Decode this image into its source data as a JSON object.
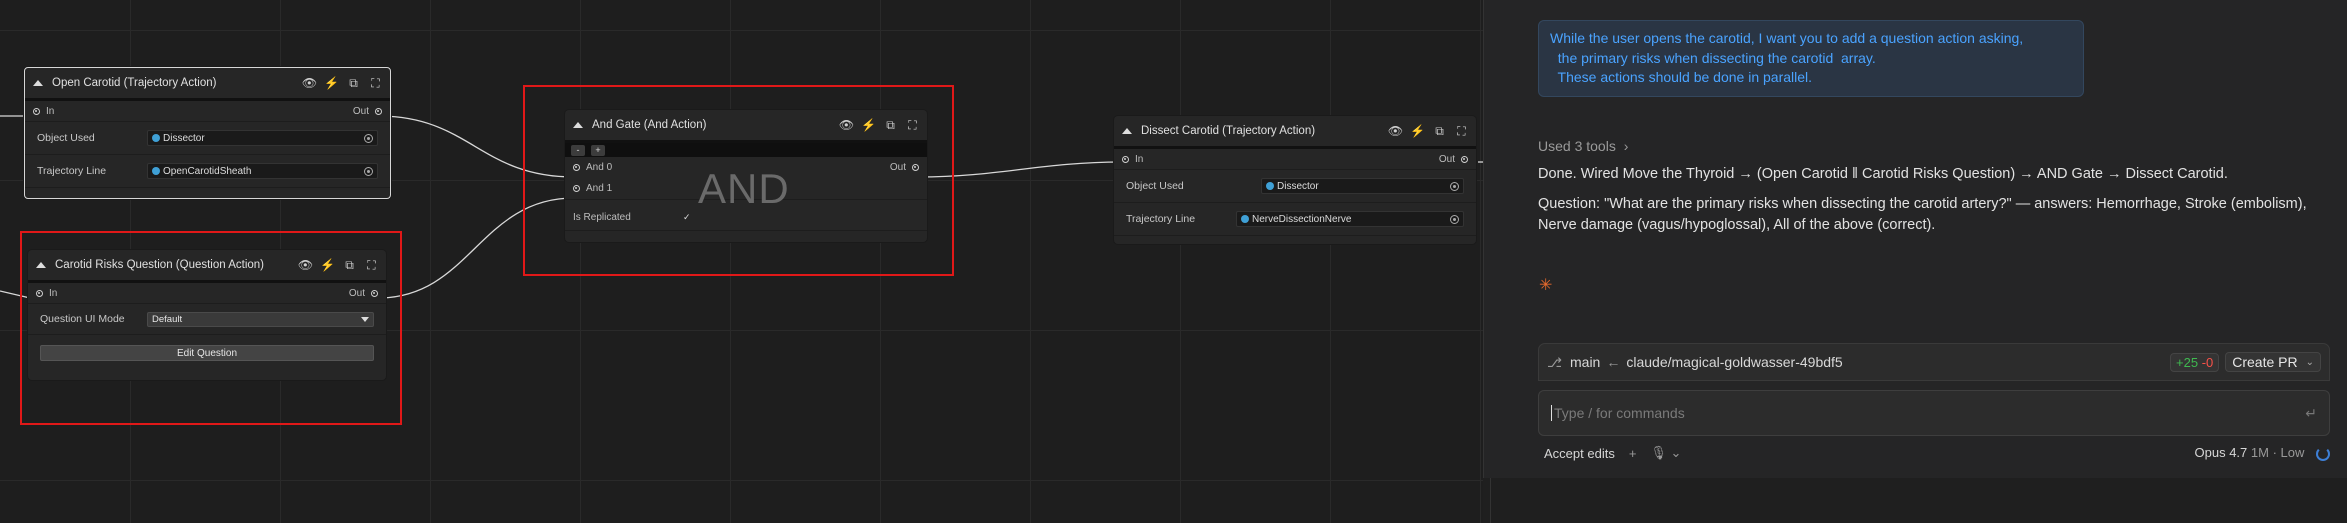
{
  "nodes": {
    "open_carotid": {
      "title": "Open Carotid (Trajectory Action)",
      "in_label": "In",
      "out_label": "Out",
      "object_used_label": "Object Used",
      "object_used_value": "Dissector",
      "trajectory_line_label": "Trajectory Line",
      "trajectory_line_value": "OpenCarotidSheath"
    },
    "risks_question": {
      "title": "Carotid Risks Question (Question Action)",
      "in_label": "In",
      "out_label": "Out",
      "ui_mode_label": "Question UI Mode",
      "ui_mode_value": "Default",
      "edit_button": "Edit Question"
    },
    "and_gate": {
      "title": "And Gate (And Action)",
      "minus": "-",
      "plus": "+",
      "and0_label": "And 0",
      "and1_label": "And 1",
      "out_label": "Out",
      "big_label": "AND",
      "replicated_label": "Is Replicated",
      "replicated_value": "✓"
    },
    "dissect_carotid": {
      "title": "Dissect Carotid (Trajectory Action)",
      "in_label": "In",
      "out_label": "Out",
      "object_used_label": "Object Used",
      "object_used_value": "Dissector",
      "trajectory_line_label": "Trajectory Line",
      "trajectory_line_value": "NerveDissectionNerve"
    }
  },
  "chat": {
    "user_message_lines": [
      "While the user opens the carotid, I want you to add a question action asking,",
      "  the primary risks when dissecting the carotid  array.",
      "  These actions should be done in parallel."
    ],
    "used_tools": "Used 3 tools",
    "used_tools_chevron": "›",
    "reply_line1": "Done. Wired Move the Thyroid → (Open Carotid ‖ Carotid Risks Question) → AND Gate → Dissect Carotid.",
    "reply_line2": "Question: \"What are the primary risks when dissecting the carotid artery?\" — answers: Hemorrhage, Stroke (embolism), Nerve damage (vagus/hypoglossal), All of the above (correct).",
    "branch_base": "main",
    "branch_arrow": "←",
    "branch_name": "claude/magical-goldwasser-49bdf5",
    "diff_added": "+25",
    "diff_removed": "-0",
    "create_pr": "Create PR",
    "input_placeholder": "Type / for commands",
    "accept_edits": "Accept edits",
    "plus": "+",
    "model": "Opus 4.7",
    "context": "1M · Low"
  },
  "colors": {
    "highlight_box": "#e01818",
    "link_blue": "#4aa3ff",
    "accent_orange": "#e66a2c",
    "diff_green": "#3fb950",
    "diff_red": "#f85149"
  }
}
